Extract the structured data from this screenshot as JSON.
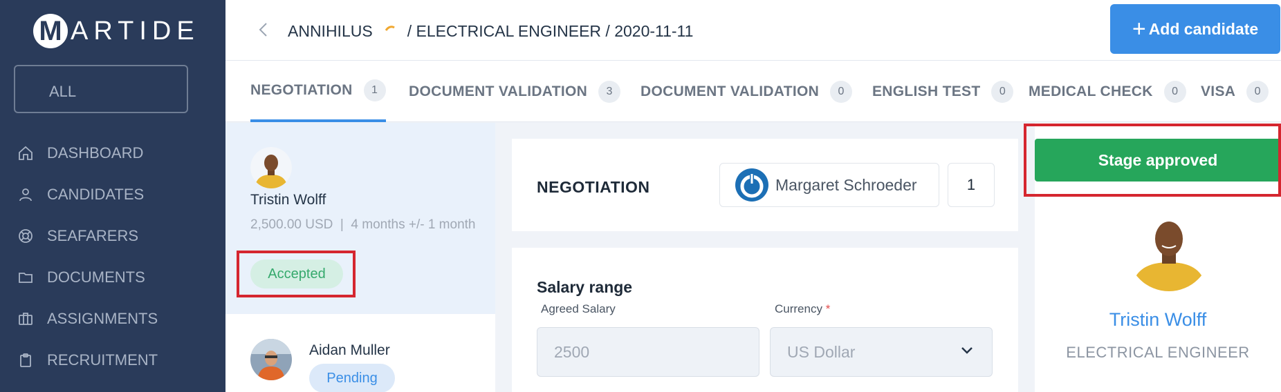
{
  "brand": {
    "logo_letter": "M",
    "logo_rest": "ARTIDE"
  },
  "sidebar": {
    "filter_label": "ALL",
    "items": [
      {
        "label": "DASHBOARD",
        "icon": "home-icon"
      },
      {
        "label": "CANDIDATES",
        "icon": "user-icon"
      },
      {
        "label": "SEAFARERS",
        "icon": "lifebuoy-icon"
      },
      {
        "label": "DOCUMENTS",
        "icon": "folder-icon"
      },
      {
        "label": "ASSIGNMENTS",
        "icon": "briefcase-icon"
      },
      {
        "label": "RECRUITMENT",
        "icon": "clipboard-icon"
      }
    ]
  },
  "header": {
    "company": "ANNIHILUS",
    "path": "/ ELECTRICAL ENGINEER / 2020-11-11",
    "add_label": "Add candidate",
    "add_icon": "plus-icon",
    "back_icon": "chevron-left-icon"
  },
  "tabs": [
    {
      "label": "NEGOTIATION",
      "count": "1"
    },
    {
      "label": "DOCUMENT VALIDATION",
      "count": "3"
    },
    {
      "label": "DOCUMENT VALIDATION",
      "count": "0"
    },
    {
      "label": "ENGLISH TEST",
      "count": "0"
    },
    {
      "label": "MEDICAL CHECK",
      "count": "0"
    },
    {
      "label": "VISA",
      "count": "0"
    }
  ],
  "candidates": [
    {
      "name": "Tristin Wolff",
      "salary": "2,500.00 USD",
      "duration": "4 months +/- 1 month",
      "status": "Accepted"
    },
    {
      "name": "Aidan Muller",
      "status": "Pending"
    }
  ],
  "negotiation": {
    "title": "NEGOTIATION",
    "recruiter": "Margaret Schroeder",
    "count": "1"
  },
  "salary": {
    "title": "Salary range",
    "agreed_label": "Agreed Salary",
    "agreed_value": "2500",
    "currency_label": "Currency",
    "currency_required": "*",
    "currency_value": "US Dollar"
  },
  "profile": {
    "stage_button": "Stage approved",
    "name": "Tristin Wolff",
    "role": "ELECTRICAL ENGINEER"
  },
  "colors": {
    "sidebar": "#2a3b5a",
    "accent": "#3a8ee6",
    "success": "#26a65b",
    "highlight": "#d5262f"
  }
}
